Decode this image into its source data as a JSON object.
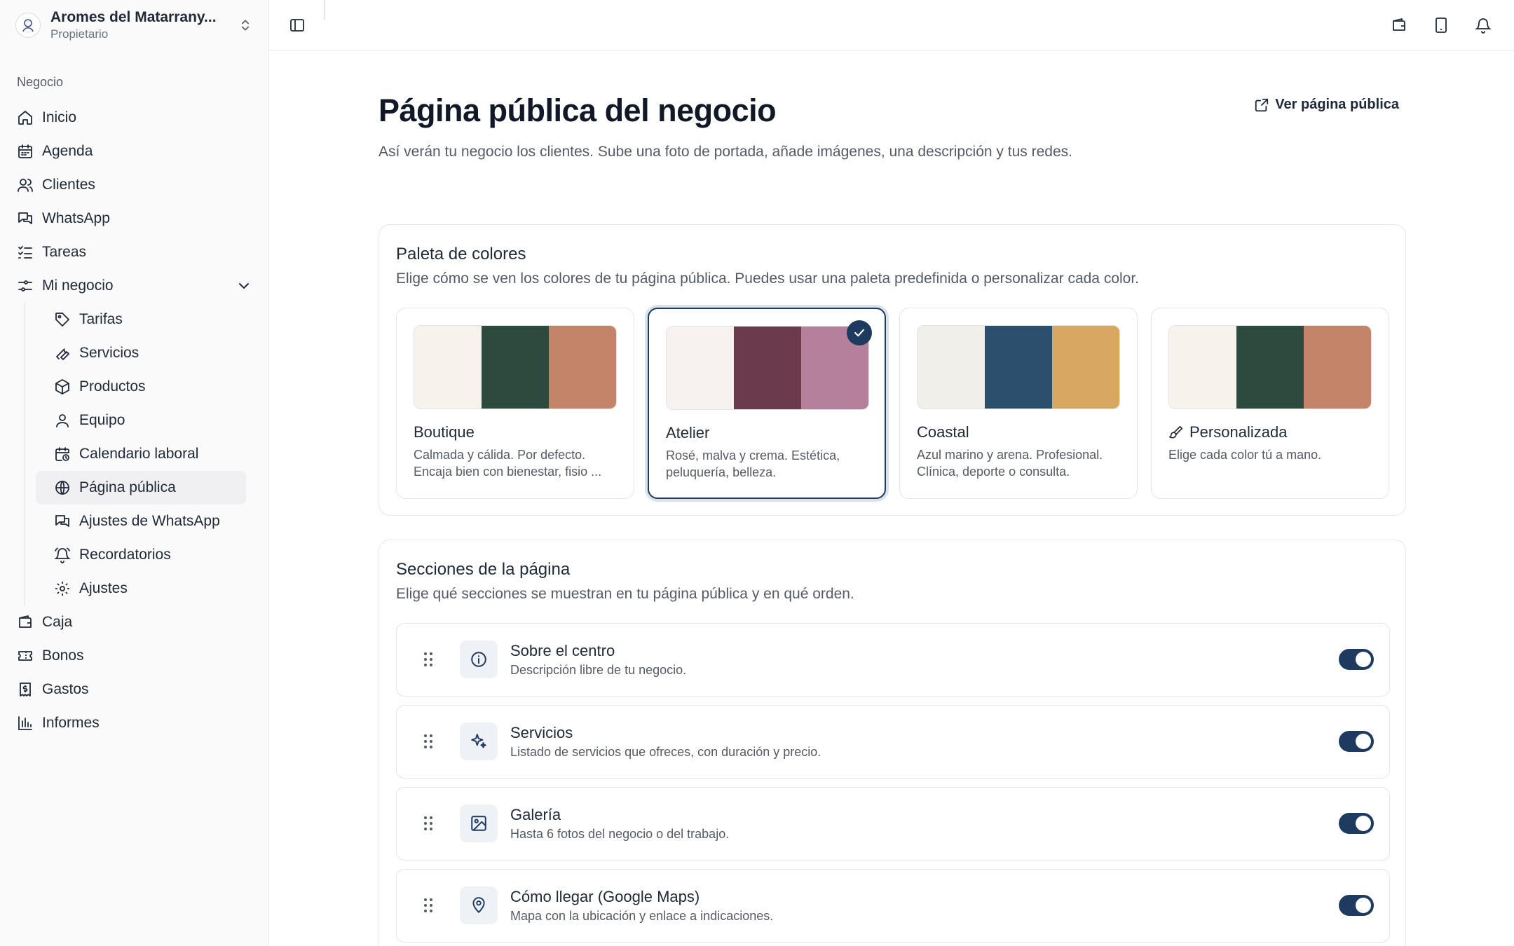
{
  "org": {
    "name": "Aromes del Matarrany...",
    "role": "Propietario"
  },
  "sidebar": {
    "group_label": "Negocio",
    "items": [
      {
        "label": "Inicio",
        "icon": "home-icon"
      },
      {
        "label": "Agenda",
        "icon": "calendar-icon"
      },
      {
        "label": "Clientes",
        "icon": "users-icon"
      },
      {
        "label": "WhatsApp",
        "icon": "chat-icon"
      },
      {
        "label": "Tareas",
        "icon": "list-check-icon"
      },
      {
        "label": "Mi negocio",
        "icon": "sliders-icon"
      }
    ],
    "subitems": [
      {
        "label": "Tarifas",
        "icon": "tag-icon"
      },
      {
        "label": "Servicios",
        "icon": "wrench-icon"
      },
      {
        "label": "Productos",
        "icon": "package-icon"
      },
      {
        "label": "Equipo",
        "icon": "user-icon"
      },
      {
        "label": "Calendario laboral",
        "icon": "calendar-clock-icon"
      },
      {
        "label": "Página pública",
        "icon": "globe-icon"
      },
      {
        "label": "Ajustes de WhatsApp",
        "icon": "chat-icon"
      },
      {
        "label": "Recordatorios",
        "icon": "bell-ring-icon"
      },
      {
        "label": "Ajustes",
        "icon": "gear-icon"
      }
    ],
    "items_after": [
      {
        "label": "Caja",
        "icon": "wallet-icon"
      },
      {
        "label": "Bonos",
        "icon": "ticket-icon"
      },
      {
        "label": "Gastos",
        "icon": "receipt-icon"
      },
      {
        "label": "Informes",
        "icon": "bar-chart-icon"
      }
    ]
  },
  "header": {
    "title": "Página pública del negocio",
    "subtitle": "Así verán tu negocio los clientes. Sube una foto de portada, añade imágenes, una descripción y tus redes.",
    "public_link": "Ver página pública"
  },
  "palette_card": {
    "title": "Paleta de colores",
    "description": "Elige cómo se ven los colores de tu página pública. Puedes usar una paleta predefinida o personalizar cada color.",
    "options": [
      {
        "name": "Boutique",
        "desc": "Calmada y cálida. Por defecto. Encaja bien con bienestar, fisio ...",
        "colors": [
          "#f7f3ec",
          "#2c4a3e",
          "#c4846a"
        ],
        "selected": false
      },
      {
        "name": "Atelier",
        "desc": "Rosé, malva y crema. Estética, peluquería, belleza.",
        "colors": [
          "#f7f2ef",
          "#6b3b4d",
          "#b5809a"
        ],
        "selected": true
      },
      {
        "name": "Coastal",
        "desc": "Azul marino y arena. Profesional. Clínica, deporte o consulta.",
        "colors": [
          "#f1efe9",
          "#2c4f6e",
          "#d8a762"
        ],
        "selected": false
      },
      {
        "name": "Personalizada",
        "desc": "Elige cada color tú a mano.",
        "colors": [
          "#f7f3ec",
          "#2c4a3e",
          "#c4846a"
        ],
        "selected": false
      }
    ]
  },
  "sections_card": {
    "title": "Secciones de la página",
    "description": "Elige qué secciones se muestran en tu página pública y en qué orden.",
    "rows": [
      {
        "title": "Sobre el centro",
        "desc": "Descripción libre de tu negocio.",
        "icon": "info-icon",
        "enabled": true
      },
      {
        "title": "Servicios",
        "desc": "Listado de servicios que ofreces, con duración y precio.",
        "icon": "sparkles-icon",
        "enabled": true
      },
      {
        "title": "Galería",
        "desc": "Hasta 6 fotos del negocio o del trabajo.",
        "icon": "image-icon",
        "enabled": true
      },
      {
        "title": "Cómo llegar (Google Maps)",
        "desc": "Mapa con la ubicación y enlace a indicaciones.",
        "icon": "map-pin-icon",
        "enabled": true
      }
    ]
  },
  "colors": {
    "accent": "#1e3a5f",
    "muted_text": "#555b66",
    "border": "#e5e7eb"
  }
}
